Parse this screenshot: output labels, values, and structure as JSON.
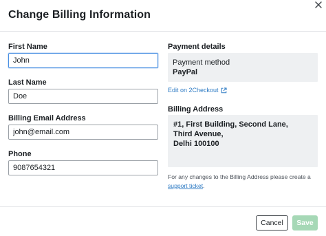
{
  "dialog": {
    "title": "Change Billing Information",
    "close_icon": "close-icon"
  },
  "form": {
    "first_name": {
      "label": "First Name",
      "value": "John"
    },
    "last_name": {
      "label": "Last Name",
      "value": "Doe"
    },
    "email": {
      "label": "Billing Email Address",
      "value": "john@email.com"
    },
    "phone": {
      "label": "Phone",
      "value": "9087654321"
    }
  },
  "payment": {
    "section_label": "Payment details",
    "method_label": "Payment method",
    "method_value": "PayPal",
    "edit_link": "Edit on 2Checkout",
    "edit_icon": "external-link-icon"
  },
  "billing_address": {
    "section_label": "Billing Address",
    "lines": [
      "#1, First Building, Second Lane,",
      "Third Avenue,",
      "Delhi 100100"
    ],
    "note_text": "For any changes to the Billing Address please create a",
    "note_link": "support ticket",
    "note_suffix": "."
  },
  "footer": {
    "cancel_label": "Cancel",
    "save_label": "Save"
  },
  "colors": {
    "link": "#2e7bc4",
    "focus_border": "#4a90e2",
    "save_disabled": "#a6d8b6",
    "info_box": "#eef0f2"
  }
}
